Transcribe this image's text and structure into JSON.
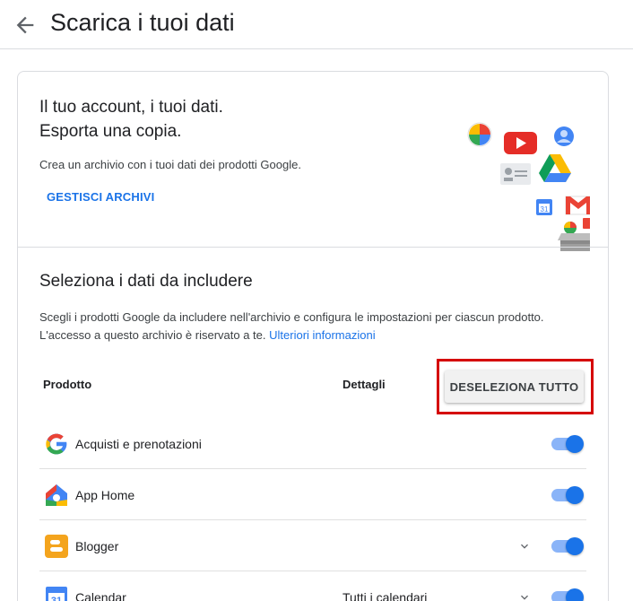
{
  "header": {
    "title": "Scarica i tuoi dati",
    "back_icon": "arrow-back-icon"
  },
  "hero": {
    "title_line1": "Il tuo account, i tuoi dati.",
    "title_line2": "Esporta una copia.",
    "description": "Crea un archivio con i tuoi dati dei prodotti Google.",
    "manage_label": "GESTISCI ARCHIVI"
  },
  "selection": {
    "title": "Seleziona i dati da includere",
    "description": "Scegli i prodotti Google da includere nell'archivio e configura le impostazioni per ciascun prodotto. L'accesso a questo archivio è riservato a te. ",
    "learn_more": "Ulteriori informazioni",
    "col_product": "Prodotto",
    "col_details": "Dettagli",
    "deselect_all": "DESELEZIONA TUTTO"
  },
  "products": [
    {
      "name": "Acquisti e prenotazioni",
      "detail": "",
      "icon": "google-g-icon",
      "expandable": false,
      "enabled": true
    },
    {
      "name": "App Home",
      "detail": "",
      "icon": "google-home-icon",
      "expandable": false,
      "enabled": true
    },
    {
      "name": "Blogger",
      "detail": "",
      "icon": "blogger-icon",
      "expandable": true,
      "enabled": true
    },
    {
      "name": "Calendar",
      "detail": "Tutti i calendari",
      "icon": "calendar-icon",
      "calendar_day": "31",
      "expandable": true,
      "enabled": true
    }
  ],
  "colors": {
    "accent": "#1a73e8",
    "toggle_track": "#8ab4f8",
    "highlight": "#d50000"
  }
}
